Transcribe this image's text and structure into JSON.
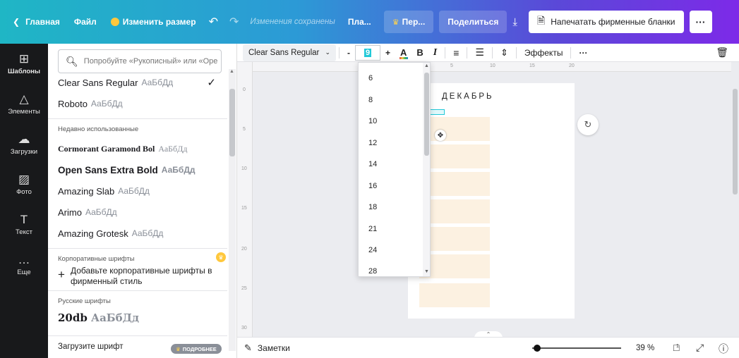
{
  "topbar": {
    "home": "Главная",
    "file": "Файл",
    "resize": "Изменить размер",
    "undo_icon": "undo-icon",
    "redo_icon": "redo-icon",
    "saved": "Изменения сохранены",
    "plan": "Пла...",
    "pro": "Пер...",
    "share": "Поделиться",
    "download_icon": "download-icon",
    "print": "Напечатать фирменные бланки",
    "more": "···"
  },
  "rail": {
    "items": [
      {
        "label": "Шаблоны",
        "icon": "templates-icon"
      },
      {
        "label": "Элементы",
        "icon": "elements-icon"
      },
      {
        "label": "Загрузки",
        "icon": "uploads-icon"
      },
      {
        "label": "Фото",
        "icon": "photo-icon"
      },
      {
        "label": "Текст",
        "icon": "text-icon"
      },
      {
        "label": "Еще",
        "icon": "more-icon"
      }
    ]
  },
  "fonts_panel": {
    "search_placeholder": "Попробуйте «Рукописный» или «Ope",
    "current": [
      {
        "name": "Clear Sans Regular",
        "sample": "АаБбДд",
        "selected": true
      },
      {
        "name": "Roboto",
        "sample": "АаБбДд"
      }
    ],
    "recent_label": "Недавно использованные",
    "recent": [
      {
        "name": "Cormorant Garamond Bol",
        "sample": "АаБбДд"
      },
      {
        "name": "Open Sans Extra Bold",
        "sample": "АаБбДд"
      },
      {
        "name": "Amazing Slab",
        "sample": "АаБбДд"
      },
      {
        "name": "Arimo",
        "sample": "АаБбДд"
      },
      {
        "name": "Amazing Grotesk",
        "sample": "АаБбДд"
      }
    ],
    "corporate_label": "Корпоративные шрифты",
    "corporate_add": "Добавьте корпоративные шрифты в фирменный стиль",
    "russian_label": "Русские шрифты",
    "russian_font": {
      "name": "20db",
      "sample": "АаБбДд"
    },
    "upload_label": "Загрузите шрифт",
    "more_badge": "ПОДРОБНЕЕ"
  },
  "toolbar2": {
    "font": "Clear Sans Regular",
    "minus": "-",
    "size": "9",
    "plus": "+",
    "text_color_label": "A",
    "bold": "B",
    "italic": "I",
    "effects": "Эффекты",
    "more": "···"
  },
  "size_dropdown": {
    "options": [
      "6",
      "8",
      "10",
      "12",
      "14",
      "16",
      "18",
      "21",
      "24",
      "28"
    ]
  },
  "canvas": {
    "page_title": "ДЕКАБРЬ",
    "ruler_h": [
      "5",
      "10",
      "15",
      "20"
    ],
    "ruler_v": [
      "0",
      "5",
      "10",
      "15",
      "20",
      "25",
      "30"
    ]
  },
  "bottombar": {
    "notes": "Заметки",
    "zoom": "39 %",
    "zoom_fraction": 0.05,
    "page_count": "1"
  }
}
